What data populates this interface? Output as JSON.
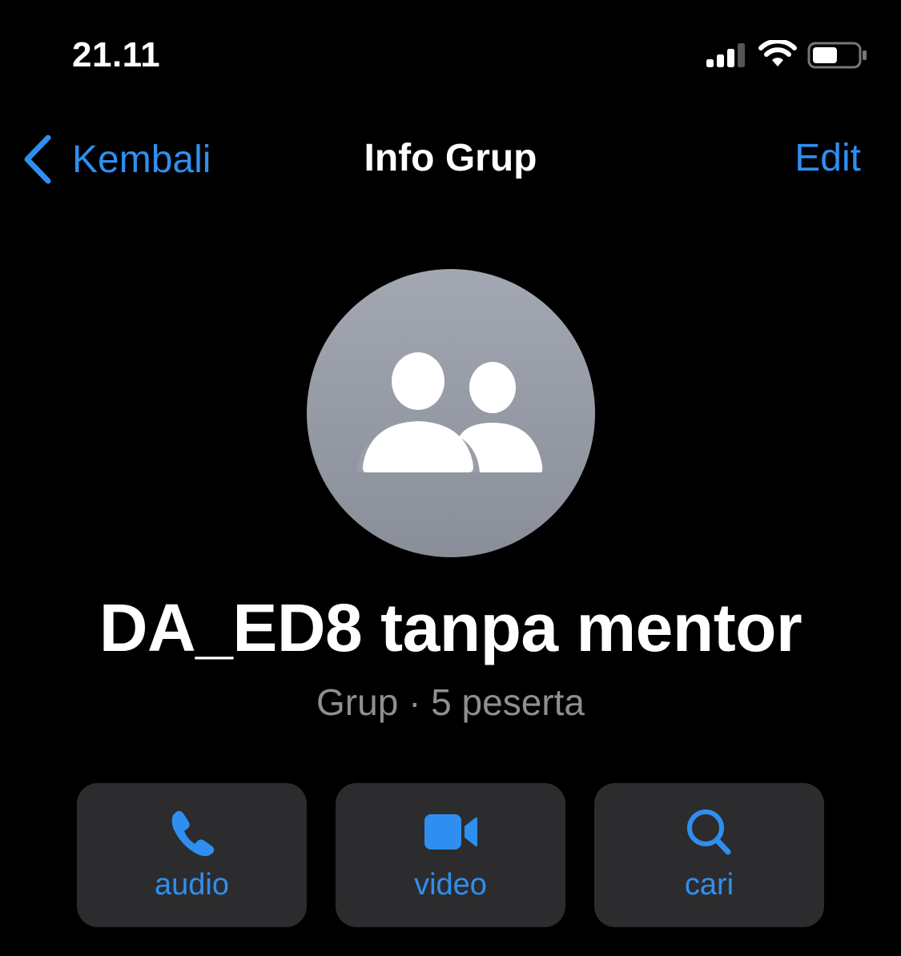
{
  "status_bar": {
    "time": "21.11",
    "icons": [
      "signal-icon",
      "wifi-icon",
      "battery-icon"
    ]
  },
  "nav": {
    "back_label": "Kembali",
    "title": "Info Grup",
    "edit_label": "Edit"
  },
  "group": {
    "avatar_icon": "group-people-icon",
    "name": "DA_ED8 tanpa mentor",
    "meta": "Grup · 5 peserta"
  },
  "actions": [
    {
      "label": "audio",
      "icon": "phone-icon"
    },
    {
      "label": "video",
      "icon": "video-camera-icon"
    },
    {
      "label": "cari",
      "icon": "search-icon"
    }
  ],
  "colors": {
    "background": "#000000",
    "accent": "#2f8ff0",
    "secondary_text": "#8e8e93",
    "button_bg": "#2c2c2e"
  }
}
